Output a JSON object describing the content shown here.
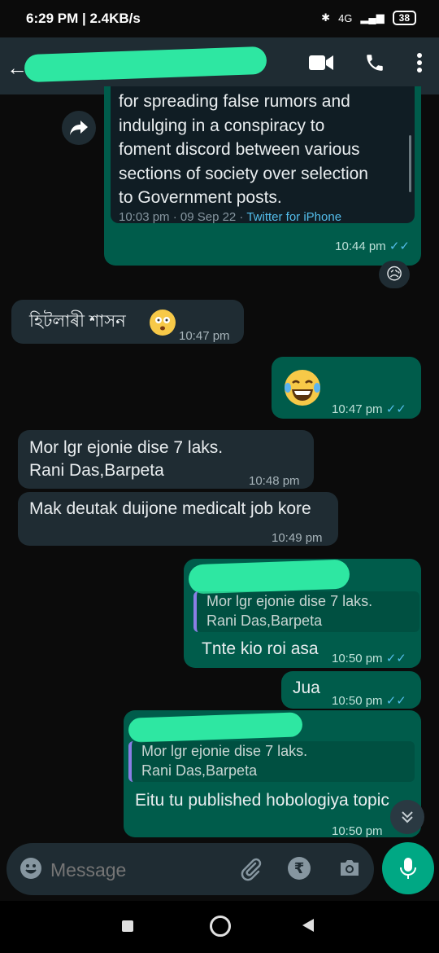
{
  "status_bar": {
    "time_speed": "6:29 PM | 2.4KB/s",
    "battery": "38",
    "network": "4G"
  },
  "header": {
    "icons": [
      "video-call-icon",
      "phone-call-icon",
      "more-icon"
    ]
  },
  "messages": {
    "tweet": {
      "lines": [
        "for spreading false rumors and",
        "indulging in a conspiracy to",
        "foment discord between various",
        "sections of society over selection",
        "to Government posts."
      ],
      "meta_time": "10:03 pm · 09 Sep 22 · ",
      "meta_source": "Twitter for iPhone",
      "time": "10:44 pm",
      "reaction": "😥"
    },
    "m1": {
      "text": "হিটলাৰী শাসন",
      "time": "10:47 pm"
    },
    "m2": {
      "time": "10:47 pm"
    },
    "m3": {
      "line1": "Mor lgr ejonie dise 7 laks.",
      "line2": "Rani Das,Barpeta",
      "time": "10:48 pm"
    },
    "m4": {
      "text": "Mak deutak duijone medicalt job kore",
      "time": "10:49 pm"
    },
    "m5": {
      "quote_line1": "Mor lgr ejonie dise 7 laks.",
      "quote_line2": "Rani Das,Barpeta",
      "text": "Tnte kio roi asa",
      "time": "10:50 pm"
    },
    "m6": {
      "text": "Jua",
      "time": "10:50 pm"
    },
    "m7": {
      "quote_line1": "Mor lgr ejonie dise 7 laks.",
      "quote_line2": "Rani Das,Barpeta",
      "text": "Eitu  tu published hobologiya topic",
      "time": "10:50 pm"
    }
  },
  "composer": {
    "placeholder": "Message"
  },
  "colors": {
    "incoming": "#1f2c33",
    "outgoing": "#005c4b",
    "accent": "#00a884",
    "redaction": "#2ee7a2"
  }
}
